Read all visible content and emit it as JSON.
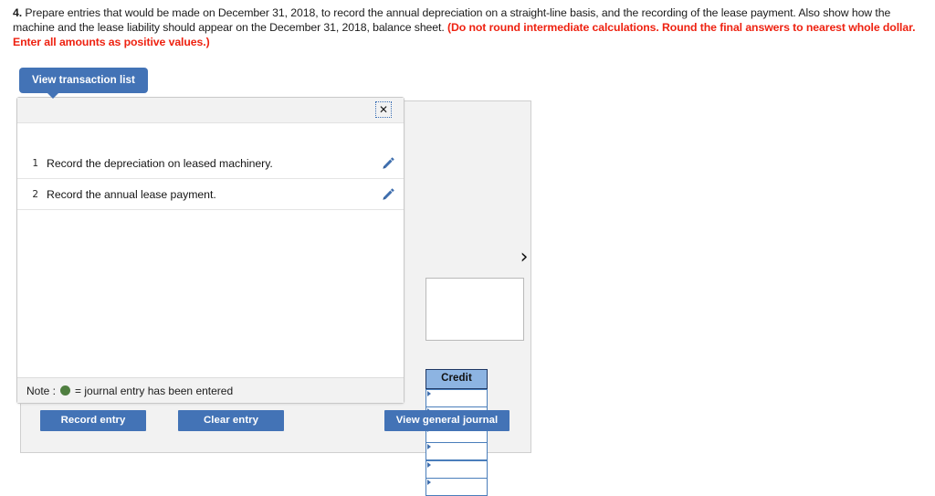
{
  "prompt": {
    "number": "4.",
    "text_main": " Prepare entries that would be made on December 31, 2018, to record the annual depreciation on a straight-line basis, and the recording of the lease payment. Also show how the machine and the lease liability should appear on the December 31, 2018, balance sheet. ",
    "text_warning": "(Do not round intermediate calculations. Round the final answers to nearest whole dollar. Enter all amounts as positive values.)"
  },
  "transaction_list": {
    "tab_label": "View transaction list",
    "close_icon": "close-icon",
    "close_glyph": "✕",
    "rows": [
      {
        "num": "1",
        "text": "Record the depreciation on leased machinery.",
        "edit_icon": "pencil-icon"
      },
      {
        "num": "2",
        "text": "Record the annual lease payment.",
        "edit_icon": "pencil-icon"
      }
    ],
    "note_prefix": "Note :",
    "note_suffix": "= journal entry has been entered",
    "note_dot_color": "#4f7e40"
  },
  "journal": {
    "credit_header": "Credit",
    "credit_rows": [
      "",
      "",
      "",
      "",
      "",
      ""
    ],
    "next_chevron": "›"
  },
  "buttons": {
    "record_entry": "Record entry",
    "clear_entry": "Clear entry",
    "view_general_journal": "View general journal"
  },
  "colors": {
    "primary_blue": "#4373b6",
    "header_blue": "#8db4e2",
    "cell_border_blue": "#4a7ebb",
    "warning_red": "#ee2211",
    "panel_gray": "#f2f2f2",
    "note_green": "#4f7e40"
  }
}
